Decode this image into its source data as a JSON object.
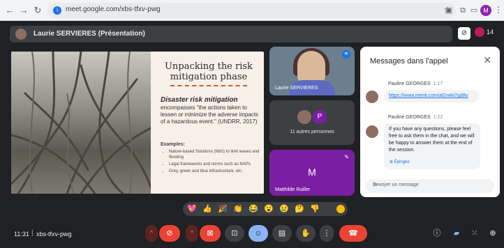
{
  "browser": {
    "url": "meet.google.com/xbs-tfxv-pwg",
    "profile_initial": "M",
    "nav": {
      "back": "←",
      "forward": "→",
      "reload": "↻"
    }
  },
  "presenter_bar": {
    "title": "Laurie SERVIERES (Présentation)"
  },
  "participants_count": "14",
  "slide": {
    "title": "Unpacking the risk mitigation phase",
    "definition_title": "Disaster risk mitigation",
    "definition_text": "encompasses \"the actions taken to lessen or minimize the adverse impacts of a hazardous event.\" (UNDRR, 2017)",
    "examples_heading": "Examples:",
    "examples": [
      "Nature-based Solutions (NbS) to limit waves and flooding",
      "Legal frameworks and norms such as NAPs",
      "Grey, green and blue infrastructure, etc."
    ]
  },
  "tiles": {
    "presenter_name": "Laurie SERVIERES",
    "others_label": "11 autres personnes",
    "others_initial": "P",
    "pinned_initial": "M",
    "pinned_name": "Matthilde Ruiller"
  },
  "chat": {
    "header": "Messages dans l'appel",
    "messages": [
      {
        "author": "Pauline GEORGES",
        "time": "1:17",
        "text": "https://www.menti.com/al2neki7gd8u"
      },
      {
        "author": "Pauline GEORGES",
        "time": "1:22",
        "text": "If you have any questions, please feel free to ask them in the chat, and we will be happy to answer them at the end of the session.",
        "pin_label": "Épingler"
      }
    ],
    "input_placeholder": "Envoyer un message"
  },
  "reactions": [
    "💖",
    "👍",
    "🎉",
    "👏",
    "😂",
    "😮",
    "😢",
    "🤔",
    "👎"
  ],
  "bottom_bar": {
    "time": "11:31",
    "separator": "|",
    "meeting_code": "xbs-tfxv-pwg"
  },
  "colors": {
    "background": "#202124",
    "accent": "#8ab4f8",
    "danger": "#ea4335",
    "purple_tile": "#7b1fa2"
  }
}
